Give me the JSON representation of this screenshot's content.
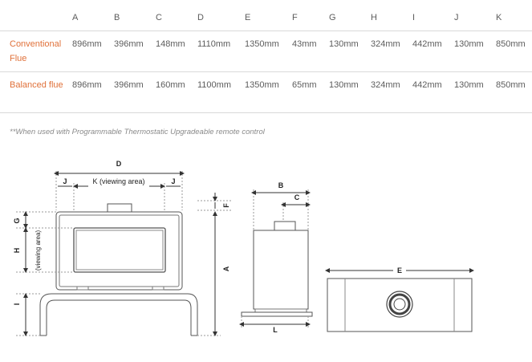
{
  "table": {
    "headers": [
      "A",
      "B",
      "C",
      "D",
      "E",
      "F",
      "G",
      "H",
      "I",
      "J",
      "K"
    ],
    "rows": [
      {
        "label": "Conventional Flue",
        "values": [
          "896mm",
          "396mm",
          "148mm",
          "1110mm",
          "1350mm",
          "43mm",
          "130mm",
          "324mm",
          "442mm",
          "130mm",
          "850mm"
        ]
      },
      {
        "label": "Balanced flue",
        "values": [
          "896mm",
          "396mm",
          "160mm",
          "1100mm",
          "1350mm",
          "65mm",
          "130mm",
          "324mm",
          "442mm",
          "130mm",
          "850mm"
        ]
      }
    ]
  },
  "footnote": "**When used with Programmable Thermostatic Upgradeable remote control",
  "diagram": {
    "front": {
      "d": "D",
      "j_left": "J",
      "k": "K (viewing area)",
      "j_right": "J",
      "f": "F",
      "a": "A",
      "g": "G",
      "h": "H",
      "h_note": "(viewing area)",
      "i": "I"
    },
    "side": {
      "b": "B",
      "c": "C",
      "l": "L"
    },
    "top": {
      "e": "E"
    }
  }
}
